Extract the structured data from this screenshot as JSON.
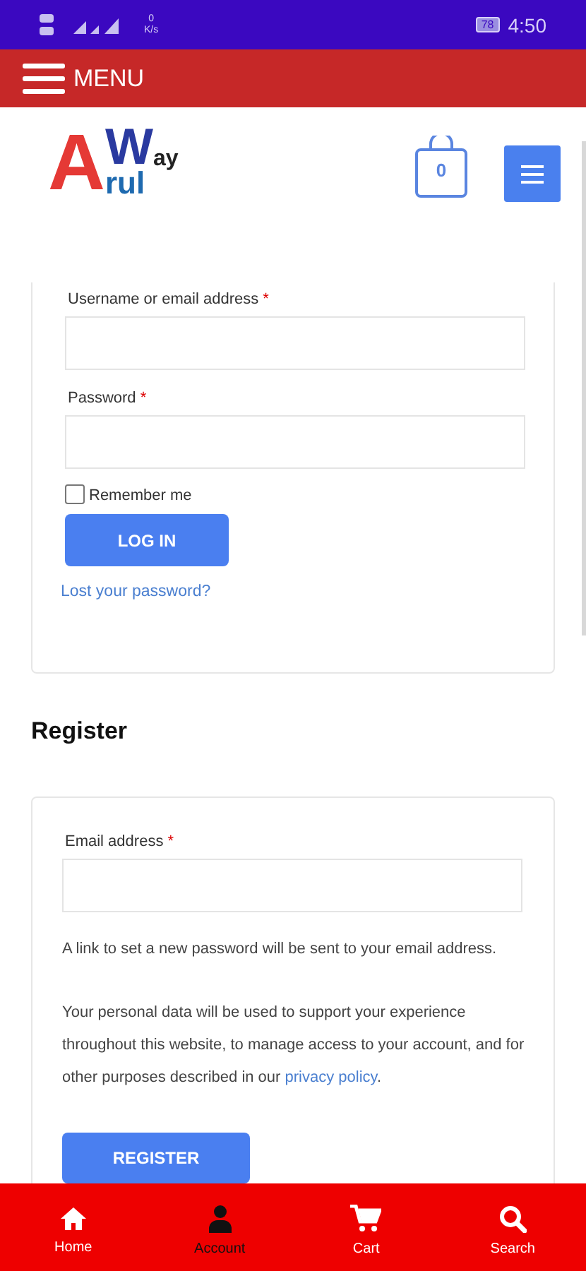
{
  "status_bar": {
    "net_speed": [
      "0",
      "K/s"
    ],
    "battery": "78",
    "time": "4:50"
  },
  "top_bar": {
    "menu_label": "MENU"
  },
  "header": {
    "logo": [
      "A",
      "W",
      "ay",
      "rul"
    ],
    "cart_count": "0"
  },
  "login": {
    "fields": [
      {
        "label": "Username or email address",
        "required_mark": "*"
      },
      {
        "label": "Password",
        "required_mark": "*"
      }
    ],
    "remember": {
      "label": "Remember me",
      "checked": false
    },
    "button": "LOG IN",
    "lost_link": "Lost your password?"
  },
  "register": {
    "heading": "Register",
    "fields": [
      {
        "label": "Email address",
        "required_mark": "*"
      }
    ],
    "note": "A link to set a new password will be sent to your email address.",
    "privacy_text": "Your personal data will be used to support your experience throughout this website, to manage access to your account, and for other purposes described in our",
    "privacy_link": "privacy policy",
    "privacy_end": ".",
    "button": "REGISTER"
  },
  "bottom_nav": [
    {
      "label": "Home",
      "kind": "home",
      "selected": false
    },
    {
      "label": "Account",
      "kind": "account",
      "selected": true
    },
    {
      "label": "Cart",
      "kind": "cart",
      "selected": false
    },
    {
      "label": "Search",
      "kind": "search",
      "selected": false
    }
  ]
}
